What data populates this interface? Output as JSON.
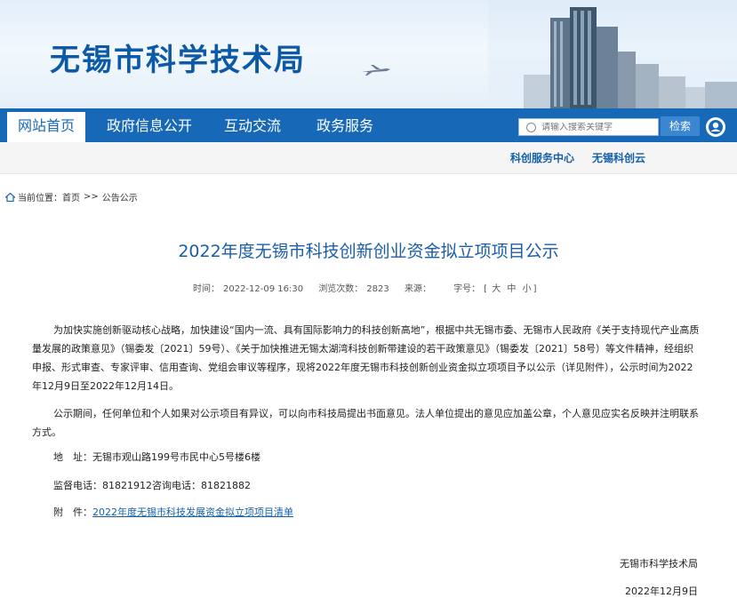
{
  "header": {
    "site_title": "无锡市科学技术局"
  },
  "nav": {
    "items": [
      {
        "label": "网站首页",
        "active": true
      },
      {
        "label": "政府信息公开",
        "active": false
      },
      {
        "label": "互动交流",
        "active": false
      },
      {
        "label": "政务服务",
        "active": false
      }
    ],
    "search_placeholder": "请输入搜索关键字",
    "search_button": "检索",
    "accessibility_icon": "accessibility-icon"
  },
  "subnav": {
    "links": [
      "科创服务中心",
      "无锡科创云"
    ]
  },
  "breadcrumb": {
    "prefix": "当前位置：",
    "home": "首页",
    "separator": ">>",
    "current": "公告公示"
  },
  "article": {
    "title": "2022年度无锡市科技创新创业资金拟立项项目公示",
    "meta": {
      "time_label": "时间：",
      "time_value": "2022-12-09 16:30",
      "views_label": "浏览次数：",
      "views_value": "2823",
      "source_label": "来源：",
      "source_value": "",
      "fontsize_label": "字号：",
      "fontsize_options": [
        "大",
        "中",
        "小"
      ]
    },
    "paragraph1": "为加快实施创新驱动核心战略，加快建设“国内一流、具有国际影响力的科技创新高地”，根据中共无锡市委、无锡市人民政府《关于支持现代产业高质量发展的政策意见》（锡委发〔2021〕59号）、《关于加快推进无锡太湖湾科技创新带建设的若干政策意见》（锡委发〔2021〕58号）等文件精神，经组织申报、形式审查、专家评审、信用查询、党组会审议等程序，现将2022年度无锡市科技创新创业资金拟立项项目予以公示（详见附件），公示时间为2022年12月9日至2022年12月14日。",
    "paragraph2": "公示期间，任何单位和个人如果对公示项目有异议，可以向市科技局提出书面意见。法人单位提出的意见应加盖公章，个人意见应实名反映并注明联系方式。",
    "address_label": "地　址：",
    "address_value": "无锡市观山路199号市民中心5号楼6楼",
    "phone_text": "监督电话：81821912咨询电话：81821882",
    "attach_label": "附　件：",
    "attach_link": "2022年度无锡市科技发展资金拟立项项目清单",
    "sign_org": "无锡市科学技术局",
    "sign_date": "2022年12月9日"
  },
  "colors": {
    "brand_blue": "#1769b8",
    "title_blue": "#1a5ea8"
  }
}
